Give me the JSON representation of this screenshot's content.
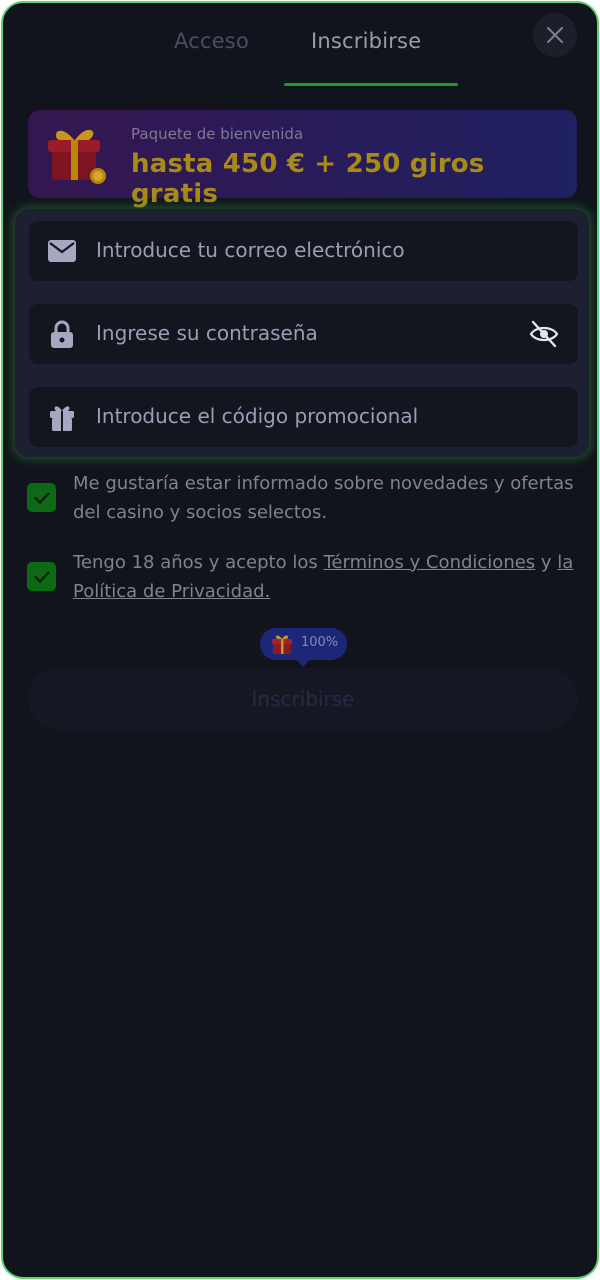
{
  "tabs": {
    "login": "Acceso",
    "signup": "Inscribirse"
  },
  "close": {
    "icon": "close-icon"
  },
  "banner": {
    "subtitle": "Paquete de bienvenida",
    "title": "hasta 450 € + 250 giros gratis",
    "icon": "gift-icon"
  },
  "fields": {
    "email": {
      "placeholder": "Introduce tu correo electrónico",
      "icon": "envelope-icon"
    },
    "password": {
      "placeholder": "Ingrese su contraseña",
      "icon": "lock-icon",
      "toggle_icon": "eye-off-icon"
    },
    "promo": {
      "placeholder": "Introduce el código promocional",
      "icon": "gift-icon"
    }
  },
  "consents": {
    "news": {
      "checked": true,
      "text": "Me gustaría estar informado sobre novedades y ofertas del casino y socios selectos."
    },
    "terms": {
      "checked": true,
      "prefix": "Tengo 18 años y acepto los ",
      "terms_link": "Términos y Condiciones",
      "middle": " y ",
      "privacy_link": "la Política de Privacidad."
    }
  },
  "progress": {
    "value": "100%"
  },
  "submit": {
    "label": "Inscribirse"
  },
  "colors": {
    "accent_green": "#1d9b2a",
    "gold": "#a88a16",
    "background": "#11141d"
  }
}
